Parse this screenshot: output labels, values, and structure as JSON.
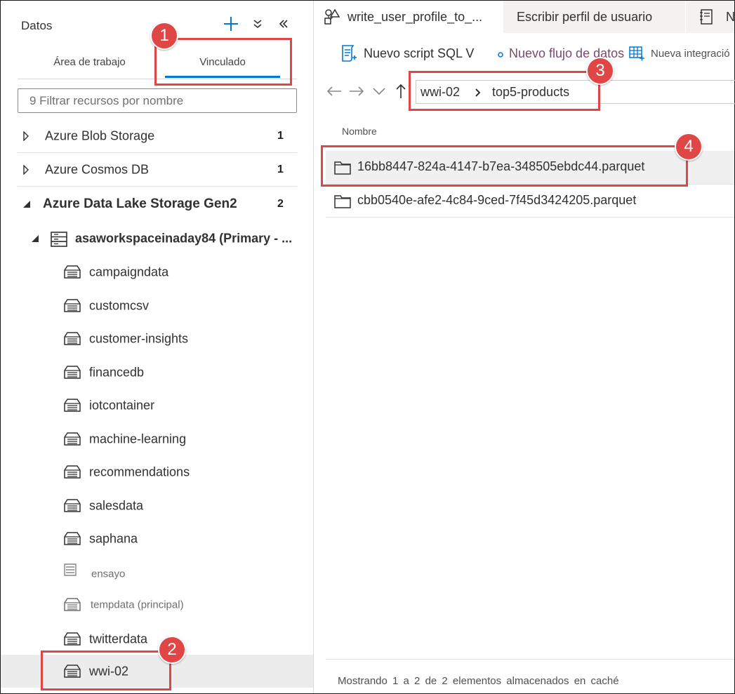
{
  "left_panel": {
    "title": "Datos",
    "tabs": {
      "workspace": "Área de trabajo",
      "linked": "Vinculado"
    },
    "filter_placeholder": "9 Filtrar recursos por nombre",
    "groups": [
      {
        "label": "Azure Blob Storage",
        "count": "1",
        "expanded": false
      },
      {
        "label": "Azure Cosmos DB",
        "count": "1",
        "expanded": false
      },
      {
        "label": "Azure Data Lake Storage Gen2",
        "count": "2",
        "expanded": true
      }
    ],
    "account": {
      "label": "asaworkspaceinaday84 (Primary - ..."
    },
    "containers": [
      "campaigndata",
      "customcsv",
      "customer-insights",
      "financedb",
      "iotcontainer",
      "machine-learning",
      "recommendations",
      "salesdata",
      "saphana",
      "ensayo",
      "tempdata (principal)",
      "twitterdata",
      "wwi-02"
    ]
  },
  "right_panel": {
    "doc_tabs": [
      "write_user_profile_to_...",
      "Escribir perfil de usuario",
      "N"
    ],
    "toolbar": {
      "new_sql": "Nuevo script SQL V",
      "new_dataflow": "Nuevo flujo de datos",
      "new_integration": "Nueva integració"
    },
    "path": [
      "wwi-02",
      "top5-products"
    ],
    "column_header": "Nombre",
    "files": [
      "16bb8447-824a-4147-b7ea-348505ebdc44.parquet",
      "cbb0540e-afe2-4c84-9ced-7f45d3424205.parquet"
    ],
    "status": "Mostrando 1 a 2 de 2 elementos almacenados en caché"
  },
  "annotations": [
    "1",
    "2",
    "3",
    "4"
  ],
  "colors": {
    "accent": "#0078d4",
    "annotation": "#e04646",
    "selected_row": "#ececec"
  }
}
